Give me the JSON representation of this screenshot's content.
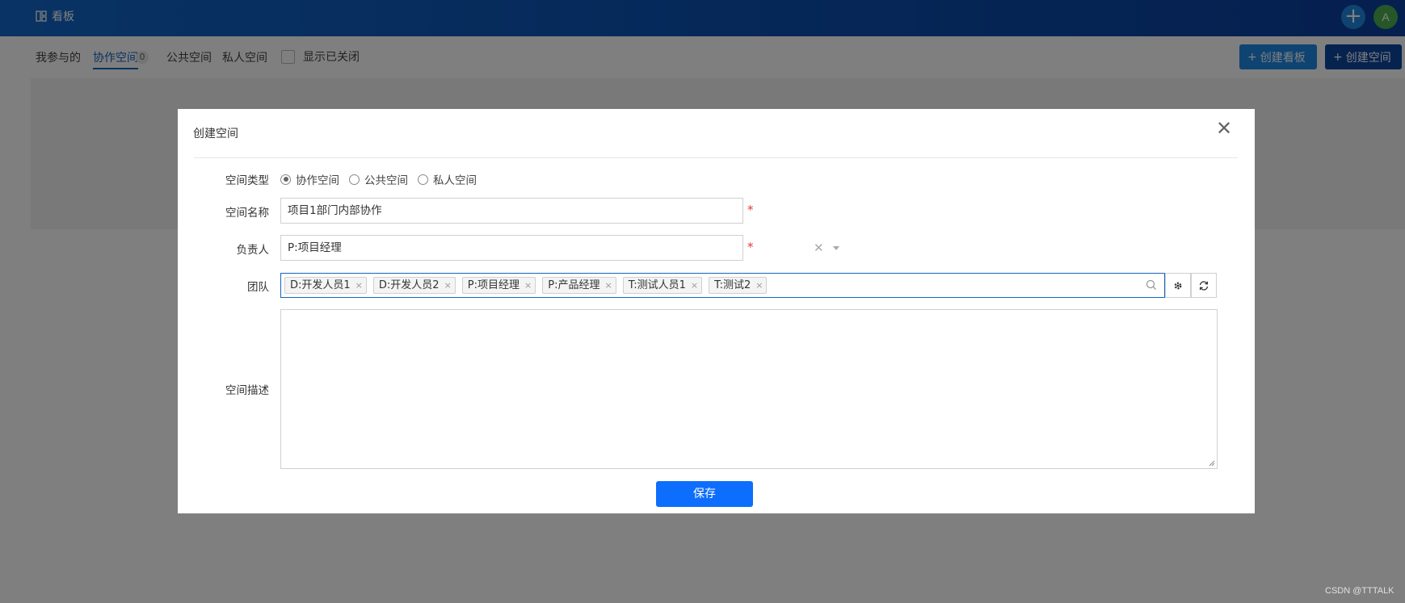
{
  "topbar": {
    "brand_label": "看板",
    "plus_symbol": "+",
    "avatar_letter": "A",
    "avatar_color": "#4caf50"
  },
  "subnav": {
    "tabs": [
      {
        "label": "我参与的"
      },
      {
        "label": "协作空间",
        "badge": "0",
        "active": true
      },
      {
        "label": "公共空间"
      },
      {
        "label": "私人空间"
      }
    ],
    "show_closed_label": "显示已关闭",
    "create_board_label": "创建看板",
    "create_space_label": "创建空间"
  },
  "modal": {
    "title": "创建空间",
    "close_symbol": "✕",
    "space_type": {
      "label": "空间类型",
      "options": [
        {
          "label": "协作空间",
          "checked": true
        },
        {
          "label": "公共空间",
          "checked": false
        },
        {
          "label": "私人空间",
          "checked": false
        }
      ]
    },
    "space_name": {
      "label": "空间名称",
      "value": "项目1部门内部协作",
      "required_mark": "*"
    },
    "owner": {
      "label": "负责人",
      "value": "P:项目经理",
      "clear_symbol": "✕",
      "required_mark": "*"
    },
    "team": {
      "label": "团队",
      "tags": [
        "D:开发人员1",
        "D:开发人员2",
        "P:项目经理",
        "P:产品经理",
        "T:测试人员1",
        "T:测试2"
      ],
      "tag_remove_symbol": "×"
    },
    "description": {
      "label": "空间描述",
      "value": ""
    },
    "save_label": "保存"
  },
  "watermark": "CSDN @TTTALK",
  "colors": {
    "primary": "#0d6efd",
    "topbar": "#0a4fb0",
    "required": "#e53935"
  }
}
